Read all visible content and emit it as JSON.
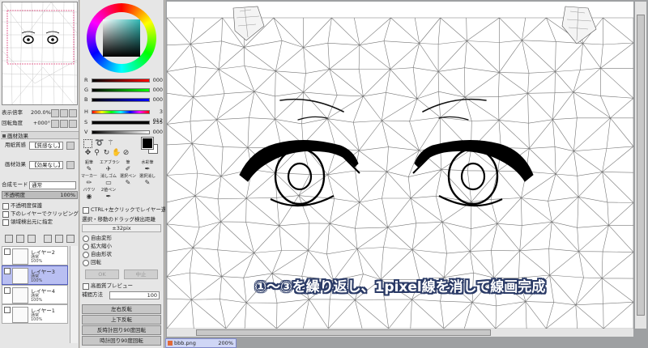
{
  "navigator": {
    "zoom_label": "表示倍率",
    "zoom_value": "200.0%",
    "rotate_label": "回転角度",
    "rotate_value": "+000°"
  },
  "paper_effect": {
    "header": "画材効果",
    "texture_label": "用紙質感",
    "texture_value": "【質感なし】",
    "effect_label": "画材効果",
    "effect_value": "【効果なし】"
  },
  "layer_props": {
    "blend_label": "合成モード",
    "blend_value": "通常",
    "opacity_label": "不透明度",
    "opacity_value": "100%",
    "protect_opacity": "不透明度保護",
    "clip_lower": "下のレイヤーでクリッピング",
    "select_source": "領域検出元に指定"
  },
  "layers": [
    {
      "name": "レイヤー2",
      "mode": "通常",
      "opacity": "100%",
      "selected": false
    },
    {
      "name": "レイヤー3",
      "mode": "通常",
      "opacity": "100%",
      "selected": true
    },
    {
      "name": "レイヤー4",
      "mode": "通常",
      "opacity": "100%",
      "selected": false
    },
    {
      "name": "レイヤー1",
      "mode": "通常",
      "opacity": "100%",
      "selected": false
    }
  ],
  "color_sliders": {
    "r": {
      "label": "R",
      "value": "000"
    },
    "g": {
      "label": "G",
      "value": "000"
    },
    "b": {
      "label": "B",
      "value": "000"
    },
    "h": {
      "label": "H",
      "value": "3 012"
    },
    "s": {
      "label": "S",
      "value": "255"
    },
    "v": {
      "label": "V",
      "value": "000"
    }
  },
  "tool_grid": [
    {
      "label": "鉛筆",
      "glyph": "✎"
    },
    {
      "label": "エアブラシ",
      "glyph": "✈"
    },
    {
      "label": "筆",
      "glyph": "✐"
    },
    {
      "label": "水彩筆",
      "glyph": "✒"
    },
    {
      "label": "マーカー",
      "glyph": "✏"
    },
    {
      "label": "消しゴム",
      "glyph": "▭"
    },
    {
      "label": "選択ペン",
      "glyph": "✎"
    },
    {
      "label": "選択消し",
      "glyph": "✎"
    },
    {
      "label": "バケツ",
      "glyph": "◉"
    },
    {
      "label": "2値ペン",
      "glyph": "✒"
    },
    {
      "label": "",
      "glyph": ""
    },
    {
      "label": "",
      "glyph": ""
    }
  ],
  "transform": {
    "ctrl_option": "CTRL+左クリックでレイヤー選択",
    "drag_threshold_label": "選択・移動のドラッグ検出距離",
    "drag_threshold_value": "±32pix",
    "modes": [
      "自由変形",
      "拡大縮小",
      "自由形状",
      "回転"
    ],
    "ok_label": "OK",
    "cancel_label": "中止",
    "hq_preview": "高画質プレビュー",
    "interp_label": "補間方法",
    "interp_value": "100",
    "flip_h": "左右反転",
    "flip_v": "上下反転",
    "rot_ccw": "反時計回り90度回転",
    "rot_cw": "時計回り90度回転"
  },
  "canvas": {
    "caption": "①～③を繰り返し、1pixel線を消して線画完成",
    "doc_name": "bbb.png",
    "doc_zoom": "200%"
  },
  "colors": {
    "selection": "#b9bff2",
    "caption_outline": "#2a3a66",
    "mesh_line": "#777777"
  }
}
